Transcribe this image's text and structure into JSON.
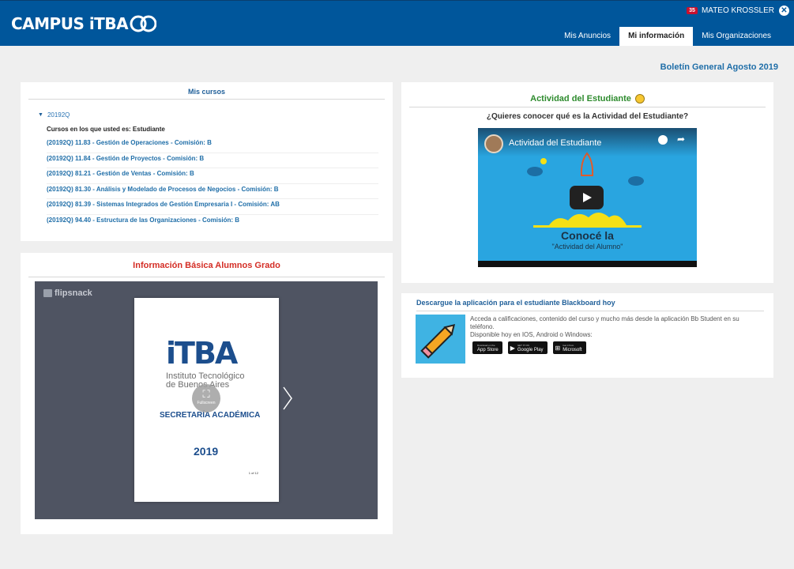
{
  "header": {
    "logo_text": "CAMPUS iTBA",
    "logo_anniversary": "60",
    "user": {
      "badge": "35",
      "name": "MATEO KROSSLER",
      "close_glyph": "✕"
    },
    "tabs": [
      {
        "label": "Mis Anuncios",
        "active": false
      },
      {
        "label": "Mi información",
        "active": true
      },
      {
        "label": "Mis Organizaciones",
        "active": false
      }
    ]
  },
  "boletin": "Boletín General Agosto 2019",
  "cursos": {
    "title": "Mis cursos",
    "period": "20192Q",
    "role_label": "Cursos en los que usted es: Estudiante",
    "items": [
      "(20192Q) 11.83 - Gestión de Operaciones - Comisión: B",
      "(20192Q) 11.84 - Gestión de Proyectos - Comisión: B",
      "(20192Q) 81.21 - Gestión de Ventas - Comisión: B",
      "(20192Q) 81.30 - Análisis y Modelado de Procesos de Negocios - Comisión: B",
      "(20192Q) 81.39 - Sistemas Integrados de Gestión Empresaria I - Comisión: AB",
      "(20192Q) 94.40 - Estructura de las Organizaciones - Comisión: B"
    ]
  },
  "info": {
    "title": "Información Básica Alumnos Grado",
    "flipsnack_label": "flipsnack",
    "page": {
      "logo": "iTBA",
      "sub_line1": "Instituto Tecnológico",
      "sub_line2": "de Buenos Aires",
      "section": "SECRETARÍA ACADÉMICA",
      "year": "2019",
      "page_num": "1 of 12"
    },
    "fullscreen_label": "Fullscreen"
  },
  "actividad": {
    "title": "Actividad del Estudiante",
    "question": "¿Quieres conocer qué es  la Actividad del Estudiante?",
    "video": {
      "title": "Actividad del Estudiante",
      "big_text": "Conocé la",
      "small_text": "\"Actividad del Alumno\""
    }
  },
  "blackboard": {
    "title": "Descargue la aplicación para el estudiante Blackboard hoy",
    "text_line1": "Acceda a calificaciones, contenido del curso y mucho más desde la aplicación Bb Student en su teléfono.",
    "text_line2": "Disponible hoy en IOS, Android o Windows:",
    "stores": [
      {
        "small": "Download on the",
        "name": "App Store",
        "icon": "apple-icon"
      },
      {
        "small": "GET IT ON",
        "name": "Google Play",
        "icon": "google-play-icon"
      },
      {
        "small": "Get it from",
        "name": "Microsoft",
        "icon": "microsoft-icon"
      }
    ]
  }
}
